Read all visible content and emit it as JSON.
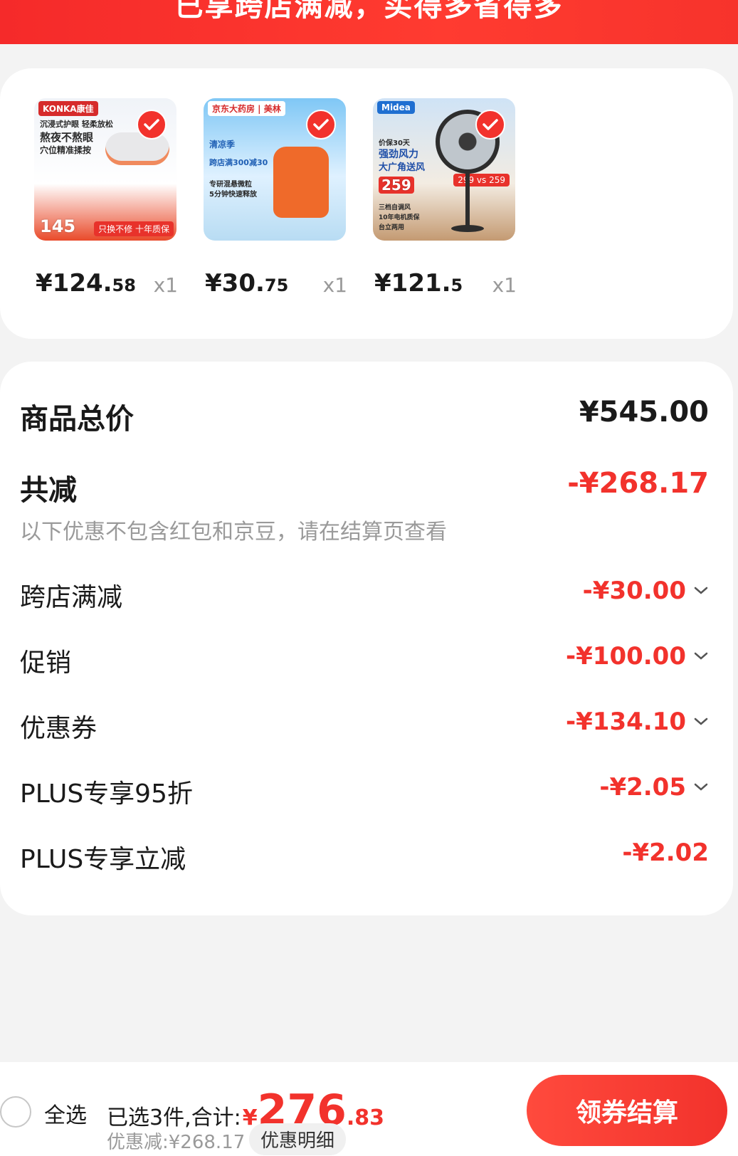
{
  "banner": {
    "text": "已享跨店满减，买得多省得多"
  },
  "products": [
    {
      "price_int": "¥124.",
      "price_dec": "58",
      "qty": "x1",
      "brand": "KONKA康佳",
      "lines": [
        "沉浸式护眼 轻柔放松",
        "熬夜不熬眼",
        "穴位精准揉按"
      ],
      "thumb_price": "145",
      "thumb_banner": "只换不修 十年质保"
    },
    {
      "price_int": "¥30.",
      "price_dec": "75",
      "qty": "x1",
      "brand": "京东大药房 | 美林",
      "lines": [
        "清凉季",
        "跨店满300减30",
        "专研混悬微粒",
        "5分钟快速释放"
      ],
      "thumb_price": "",
      "thumb_banner": ""
    },
    {
      "price_int": "¥121.",
      "price_dec": "5",
      "qty": "x1",
      "brand": "Midea",
      "lines": [
        "价保30天",
        "强劲风力",
        "大广角送风",
        "三档自调风",
        "10年电机质保",
        "台立两用"
      ],
      "thumb_price": "259",
      "thumb_banner": "299 vs 259"
    }
  ],
  "summary": {
    "total_label": "商品总价",
    "total_value": "¥545.00",
    "reduce_label": "共减",
    "reduce_value": "-¥268.17",
    "note": "以下优惠不包含红包和京豆，请在结算页查看",
    "items": [
      {
        "label": "跨店满减",
        "value": "-¥30.00",
        "expandable": true
      },
      {
        "label": "促销",
        "value": "-¥100.00",
        "expandable": true
      },
      {
        "label": "优惠券",
        "value": "-¥134.10",
        "expandable": true
      },
      {
        "label": "PLUS专享95折",
        "value": "-¥2.05",
        "expandable": true
      },
      {
        "label": "PLUS专享立减",
        "value": "-¥2.02",
        "expandable": false
      }
    ]
  },
  "bottom": {
    "select_all": "全选",
    "selected_text": "已选3件,合计:",
    "currency": "¥",
    "total_int": "276",
    "total_dec": ".83",
    "discount_text": "优惠减:¥268.17",
    "detail_button": "优惠明细",
    "checkout_button": "领券结算"
  },
  "colors": {
    "accent": "#f2322c",
    "muted": "#9a9a9a",
    "background": "#f3f3f3"
  },
  "icons": [
    "check-icon",
    "chevron-down-icon",
    "radio-icon"
  ]
}
